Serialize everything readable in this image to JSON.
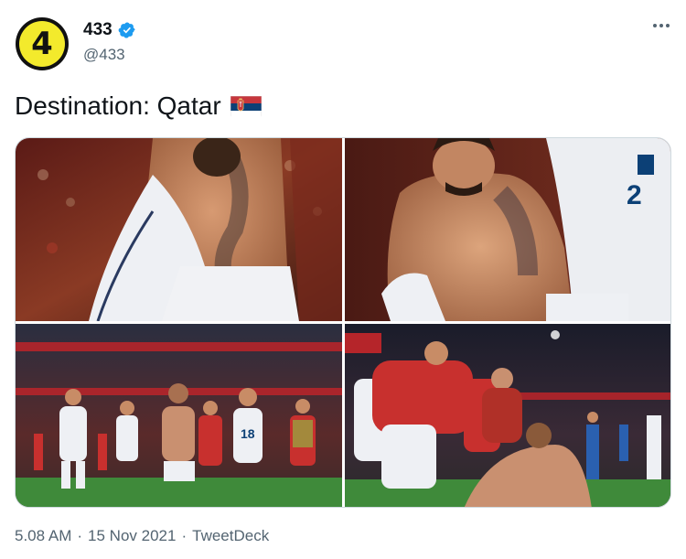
{
  "tweet": {
    "avatar_text": "4",
    "display_name": "433",
    "handle": "@433",
    "text": "Destination: Qatar",
    "flag_icon": "serbia-flag-icon",
    "verified_icon": "verified-badge-icon",
    "timestamp": "5.08 AM",
    "date": "15 Nov 2021",
    "source": "TweetDeck",
    "separator": "·"
  },
  "media": {
    "photos": [
      {
        "name": "photo-player-removing-shirt",
        "jersey_number": ""
      },
      {
        "name": "photo-player-closeup-teammate",
        "jersey_number": "2"
      },
      {
        "name": "photo-team-celebration-run",
        "jersey_number": "18"
      },
      {
        "name": "photo-team-pileup-celebration",
        "jersey_number": ""
      }
    ]
  },
  "colors": {
    "brand_yellow": "#f3ea2c",
    "verified_blue": "#1d9bf0",
    "text_primary": "#0f1419",
    "text_secondary": "#536471",
    "serbia_red": "#c6363c",
    "serbia_blue": "#0c4076"
  }
}
